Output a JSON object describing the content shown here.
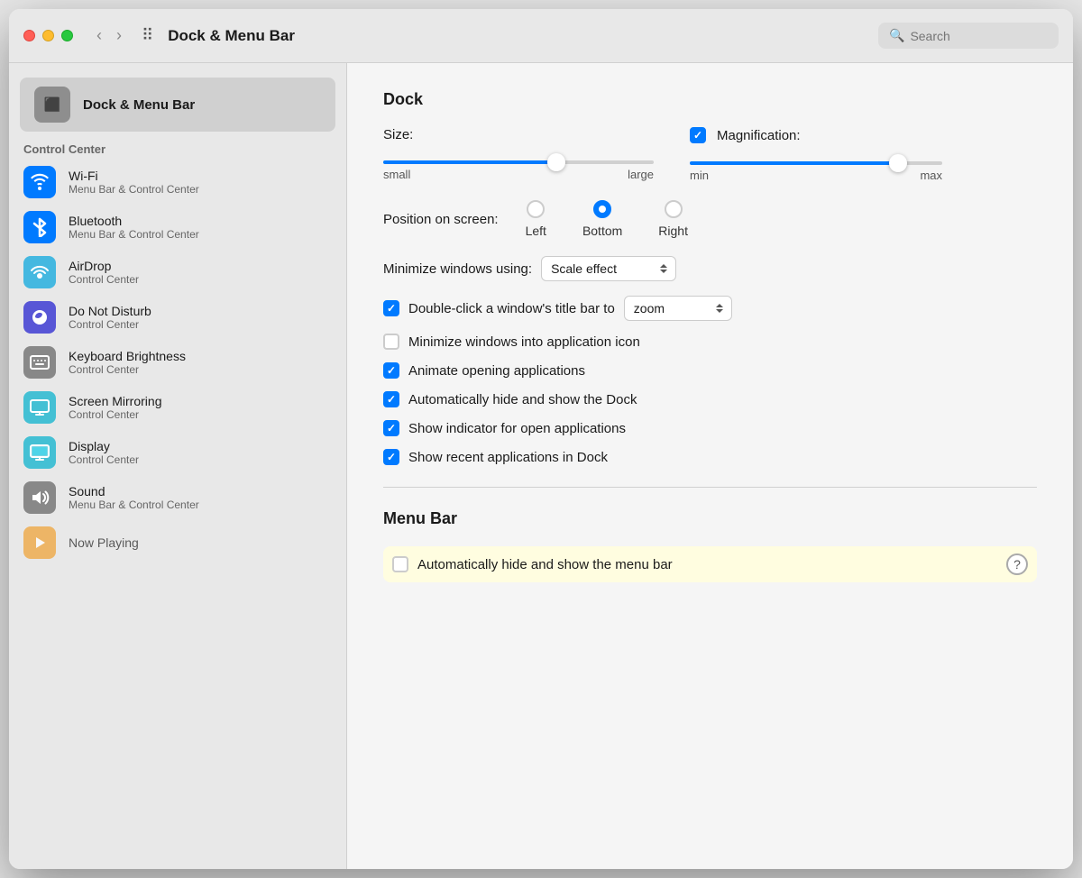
{
  "window": {
    "title": "Dock & Menu Bar"
  },
  "search": {
    "placeholder": "Search"
  },
  "sidebar": {
    "dock_item": {
      "label": "Dock & Menu Bar",
      "icon": "🖥"
    },
    "control_center_label": "Control Center",
    "items": [
      {
        "id": "wifi",
        "label": "Wi-Fi",
        "sublabel": "Menu Bar & Control Center",
        "icon_class": "icon-wifi",
        "icon": "📶"
      },
      {
        "id": "bluetooth",
        "label": "Bluetooth",
        "sublabel": "Menu Bar & Control Center",
        "icon_class": "icon-bluetooth",
        "icon": "B"
      },
      {
        "id": "airdrop",
        "label": "AirDrop",
        "sublabel": "Control Center",
        "icon_class": "icon-airdrop",
        "icon": "◉"
      },
      {
        "id": "dnd",
        "label": "Do Not Disturb",
        "sublabel": "Control Center",
        "icon_class": "icon-dnd",
        "icon": "🌙"
      },
      {
        "id": "keyboard",
        "label": "Keyboard Brightness",
        "sublabel": "Control Center",
        "icon_class": "icon-keyboard",
        "icon": "☀"
      },
      {
        "id": "mirroring",
        "label": "Screen Mirroring",
        "sublabel": "Control Center",
        "icon_class": "icon-mirroring",
        "icon": "⬜"
      },
      {
        "id": "display",
        "label": "Display",
        "sublabel": "Control Center",
        "icon_class": "icon-display",
        "icon": "🖥"
      },
      {
        "id": "sound",
        "label": "Sound",
        "sublabel": "Menu Bar & Control Center",
        "icon_class": "icon-sound",
        "icon": "🔊"
      },
      {
        "id": "nowplaying",
        "label": "Now Playing",
        "sublabel": "",
        "icon_class": "icon-nowplaying",
        "icon": "▶"
      }
    ]
  },
  "main": {
    "dock_section": {
      "header": "Dock",
      "size_label": "Size:",
      "magnification_label": "Magnification:",
      "size_min": "small",
      "size_max": "large",
      "mag_min": "min",
      "mag_max": "max",
      "position_label": "Position on screen:",
      "position_left": "Left",
      "position_bottom": "Bottom",
      "position_right": "Right",
      "minimize_label": "Minimize windows using:",
      "minimize_value": "Scale effect",
      "double_click_label": "Double-click a window's title bar to",
      "double_click_value": "zoom",
      "checkboxes": [
        {
          "id": "minimize-app-icon",
          "label": "Minimize windows into application icon",
          "checked": false
        },
        {
          "id": "animate",
          "label": "Animate opening applications",
          "checked": true
        },
        {
          "id": "auto-hide",
          "label": "Automatically hide and show the Dock",
          "checked": true
        },
        {
          "id": "indicator",
          "label": "Show indicator for open applications",
          "checked": true
        },
        {
          "id": "recent-apps",
          "label": "Show recent applications in Dock",
          "checked": true
        }
      ]
    },
    "menu_bar_section": {
      "header": "Menu Bar",
      "auto_hide_label": "Automatically hide and show the menu bar"
    }
  }
}
